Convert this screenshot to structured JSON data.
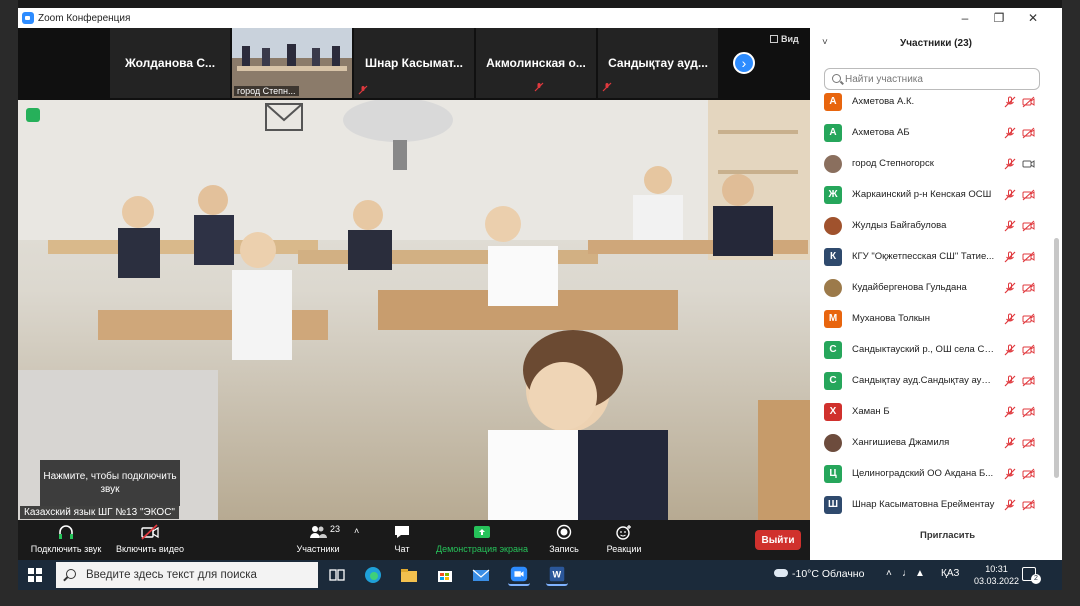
{
  "window": {
    "title": "Zoom Конференция"
  },
  "strip": {
    "tiles": [
      {
        "name": "Жолданова С..."
      },
      {
        "name": "город Степн...",
        "is_video": true
      },
      {
        "name": "Шнар Касымат..."
      },
      {
        "name": "Акмолинская о..."
      },
      {
        "name": "Сандықтау ауд..."
      }
    ],
    "view_label": "Вид"
  },
  "video": {
    "audio_prompt": "Нажмите, чтобы подключить звук",
    "speaker": "Казахский язык ШГ №13 \"ЭКОС\""
  },
  "toolbar": {
    "join_audio": "Подключить звук",
    "start_video": "Включить видео",
    "participants": "Участники",
    "participants_count": "23",
    "chat": "Чат",
    "share_screen": "Демонстрация экрана",
    "record": "Запись",
    "reactions": "Реакции",
    "leave": "Выйти"
  },
  "panel": {
    "title": "Участники (23)",
    "search_placeholder": "Найти участника",
    "invite": "Пригласить",
    "participants": [
      {
        "initial": "А",
        "name": "Ахметова А.К.",
        "color": "#e8650e",
        "camera": "off"
      },
      {
        "initial": "А",
        "name": "Ахметова АБ",
        "color": "#26a65b",
        "camera": "off"
      },
      {
        "initial": "",
        "name": "город Степногорск",
        "color": "#8a6f5e",
        "camera": "on",
        "photo": true
      },
      {
        "initial": "Ж",
        "name": "Жаркаинский р-н Кенская ОСШ",
        "color": "#26a65b",
        "camera": "off"
      },
      {
        "initial": "",
        "name": "Жулдыз Байгабулова",
        "color": "#a0522d",
        "camera": "off",
        "photo": true
      },
      {
        "initial": "К",
        "name": "КГУ \"Оқжетпесская СШ\" Татие...",
        "color": "#2f4a6d",
        "camera": "off"
      },
      {
        "initial": "",
        "name": "Кудайбергенова Гульдана",
        "color": "#9c7a4a",
        "camera": "off",
        "photo": true
      },
      {
        "initial": "М",
        "name": "Муханова Толкын",
        "color": "#e8650e",
        "camera": "off"
      },
      {
        "initial": "С",
        "name": "Сандыктауский р., ОШ села Са...",
        "color": "#26a65b",
        "camera": "off"
      },
      {
        "initial": "С",
        "name": "Сандықтау ауд.Сандықтау ауыл...",
        "color": "#26a65b",
        "camera": "off"
      },
      {
        "initial": "Х",
        "name": "Хаман Б",
        "color": "#d0312d",
        "camera": "off"
      },
      {
        "initial": "",
        "name": "Хангишиева Джамиля",
        "color": "#6d4c3d",
        "camera": "off",
        "photo": true
      },
      {
        "initial": "Ц",
        "name": "Целиноградский ОО Акдана Б...",
        "color": "#26a65b",
        "camera": "off"
      },
      {
        "initial": "Ш",
        "name": "Шнар Касыматовна Ерейментау",
        "color": "#2f4a6d",
        "camera": "off"
      }
    ]
  },
  "taskbar": {
    "search_placeholder": "Введите здесь текст для поиска",
    "weather": "-10°C Облачно",
    "language": "ҚАЗ",
    "time": "10:31",
    "date": "03.03.2022",
    "notification_count": "2"
  },
  "colors": {
    "zoom_blue": "#2d8cff",
    "leave_red": "#d0312d",
    "share_green": "#26c25a",
    "muted_red": "#e0393e"
  }
}
